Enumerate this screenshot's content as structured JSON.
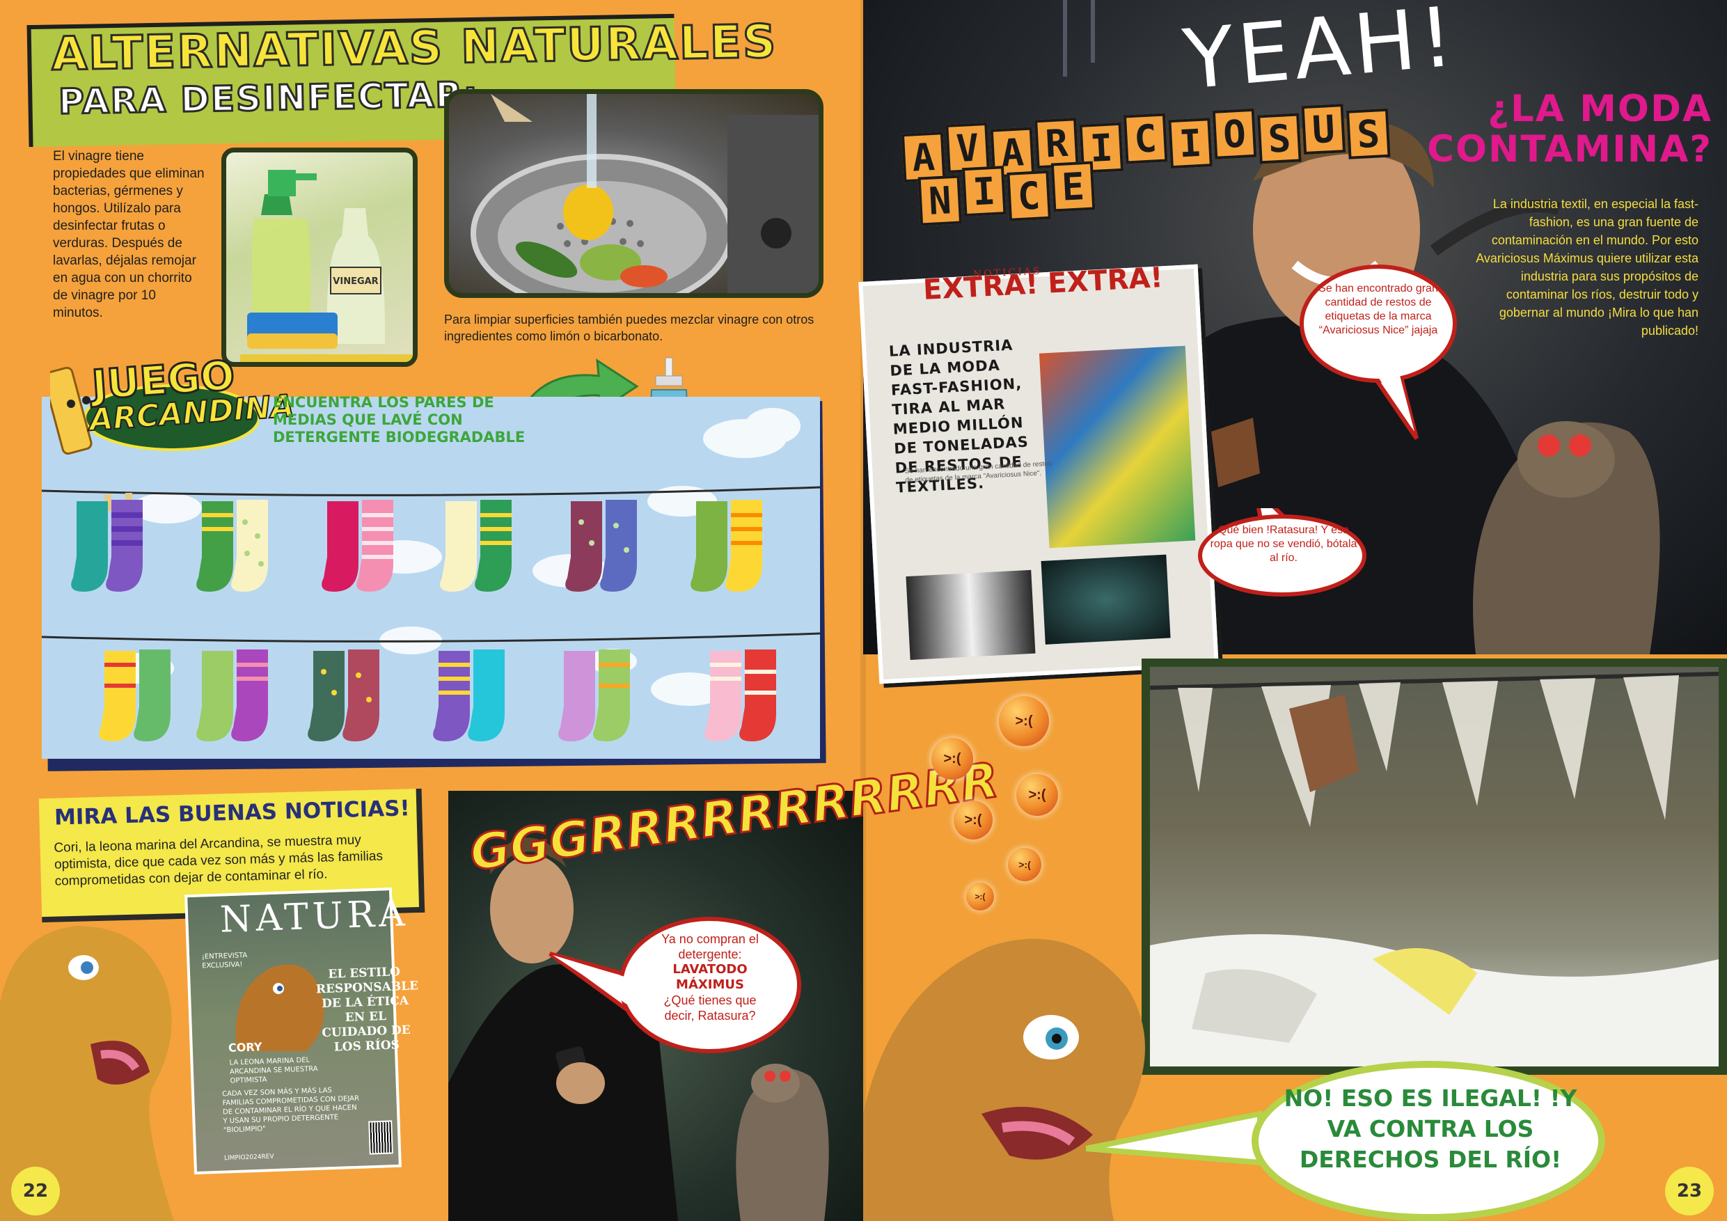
{
  "left_page": {
    "header": {
      "title": "ALTERNATIVAS NATURALES",
      "subtitle": "PARA DESINFECTAR:"
    },
    "vinegar_text": "El vinagre  tiene propiedades que eliminan bacterias, gérmenes y hongos. Utilízalo para desinfectar frutas o verduras. Después de lavarlas, déjalas remojar en agua con un chorrito de vinagre por 10 minutos.",
    "vinegar_label": "VINEGAR",
    "surface_text": "Para limpiar superficies también puedes mezclar vinagre con otros ingredientes como limón o  bicarbonato.",
    "game": {
      "title_line1": "JUEGO",
      "title_line2": "ARCANDINA",
      "instructions": "ENCUENTRA LOS PARES DE MEDIAS QUE LAVÉ CON DETERGENTE BIODEGRADABLE"
    },
    "news": {
      "title": "MIRA LAS BUENAS NOTICIAS!",
      "text": "Cori, la leona marina del Arcandina, se muestra muy optimista, dice que cada vez son más y más las familias comprometidas con dejar de contaminar el río."
    },
    "magazine": {
      "title": "NATURA",
      "interview": "¡ENTREVISTA EXCLUSIVA!",
      "headline": "EL ESTILO RESPONSABLE DE LA ÉTICA EN EL CUIDADO DE LOS RÍOS",
      "name": "CORY",
      "caption": "LA LEONA MARINA DEL ARCANDINA SE MUESTRA OPTIMISTA",
      "body": "CADA VEZ SON MÁS Y MÁS LAS FAMILIAS COMPROMETIDAS CON DEJAR DE CONTAMINAR EL RÍO Y QUE HACEN Y USAN SU PROPIO DETERGENTE \"BIOLIMPIO\"",
      "code": "LIMPIO2024REV"
    },
    "growl": "GGGRRRRRRRRRRR",
    "bubble": {
      "line1": "Ya no compran el detergente:",
      "brand": "LAVATODO MÁXIMUS",
      "line2": "¿Qué tienes que decir, Ratasura?"
    },
    "page_number": "22"
  },
  "right_page": {
    "yeah": "YEAH!",
    "brand_letters_top": [
      "A",
      "V",
      "A",
      "R",
      "I",
      "C",
      "I",
      "O",
      "S",
      "U",
      "S"
    ],
    "brand_letters_bottom": [
      "N",
      "I",
      "C",
      "E"
    ],
    "moda_title": "¿LA MODA CONTAMINA?",
    "moda_text": "La industria textil, en especial la fast-fashion, es una gran fuente de contaminación en el mundo. Por esto Avariciosus Máximus quiere utilizar esta industria para sus propósitos de contaminar los ríos, destruir todo y  gobernar al mundo ¡Mira lo que han publicado!",
    "newspaper": {
      "kicker": "NOTICIAS",
      "extra": "EXTRA! EXTRA!",
      "headline": "LA INDUSTRIA DE LA MODA FAST-FASHION, TIRA AL MAR MEDIO MILLÓN DE TONELADAS DE RESTOS DE TEXTILES.",
      "body": "Se han encontrado una gran cantidad de restos de etiquetas de la marca \"Avariciosus Nice\"."
    },
    "bubble_top": "Se han encontrado gran cantidad de restos de etiquetas de la marca “Avariciosus Nice” jajaja",
    "bubble_mid": "Qué bien !Ratasura! Y esa ropa que no se vendió, bótala al río.",
    "bubble_bottom": "NO!   ESO ES ILEGAL! !Y VA CONTRA LOS DERECHOS DEL RÍO!",
    "page_number": "23"
  },
  "colors": {
    "page_orange": "#f5a23c",
    "header_green": "#b2c743",
    "title_yellow": "#f7e43a",
    "game_blue": "#b9d8f0",
    "navy": "#202a60",
    "bubble_red": "#c0201a",
    "pink": "#e0198c",
    "river_frame": "#2e4722",
    "bubble_green": "#b6d24a"
  }
}
